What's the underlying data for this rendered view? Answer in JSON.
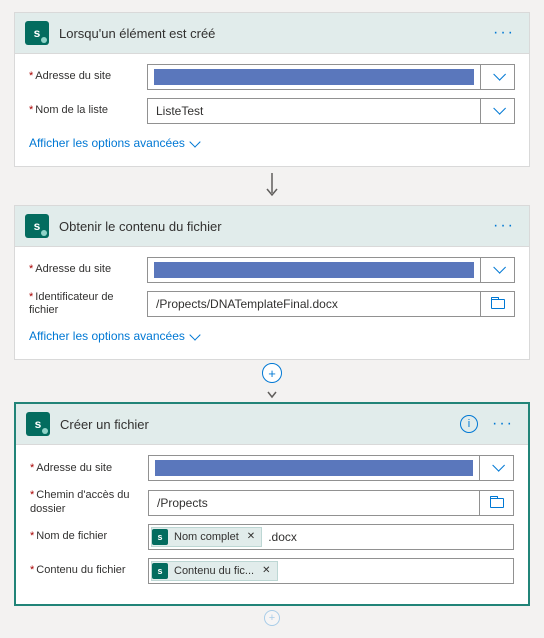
{
  "card1": {
    "title": "Lorsqu'un élément est créé",
    "site_label": "Adresse du site",
    "site_value": "",
    "list_label": "Nom de la liste",
    "list_value": "ListeTest",
    "advanced": "Afficher les options avancées"
  },
  "card2": {
    "title": "Obtenir le contenu du fichier",
    "site_label": "Adresse du site",
    "site_value": "",
    "fileid_label": "Identificateur de fichier",
    "fileid_value": "/Propects/DNATemplateFinal.docx",
    "advanced": "Afficher les options avancées"
  },
  "card3": {
    "title": "Créer un fichier",
    "site_label": "Adresse du site",
    "site_value": "",
    "folder_label": "Chemin d'accès du dossier",
    "folder_value": "/Propects",
    "filename_label": "Nom de fichier",
    "filename_token": "Nom complet",
    "filename_suffix": ".docx",
    "content_label": "Contenu du fichier",
    "content_token": "Contenu du fic..."
  }
}
